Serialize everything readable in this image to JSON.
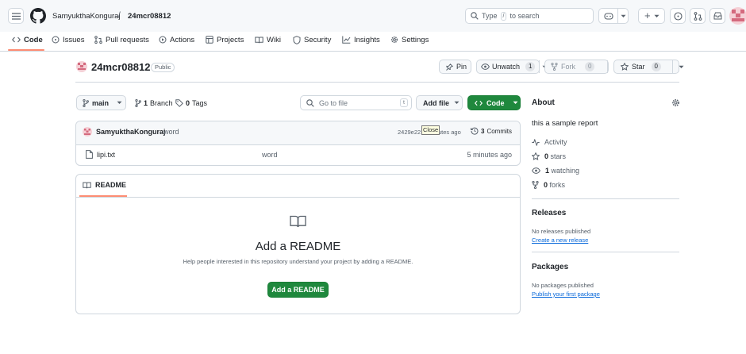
{
  "header": {
    "owner": "SamyukthaKonguraj",
    "separator": "/",
    "repo": "24mcr08812",
    "search_prefix": "Type",
    "search_key": "/",
    "search_suffix": "to search",
    "plus_label": "+"
  },
  "tabs": [
    {
      "label": "Code"
    },
    {
      "label": "Issues"
    },
    {
      "label": "Pull requests"
    },
    {
      "label": "Actions"
    },
    {
      "label": "Projects"
    },
    {
      "label": "Wiki"
    },
    {
      "label": "Security"
    },
    {
      "label": "Insights"
    },
    {
      "label": "Settings"
    }
  ],
  "repo_header": {
    "name": "24mcr08812",
    "visibility": "Public",
    "pin": "Pin",
    "unwatch": "Unwatch",
    "unwatch_count": "1",
    "fork": "Fork",
    "fork_count": "0",
    "star": "Star",
    "star_count": "0"
  },
  "toolbar": {
    "branch": "main",
    "branch_count": "1",
    "branch_word": "Branch",
    "tag_count": "0",
    "tag_word": "Tags",
    "goto_placeholder": "Go to file",
    "goto_key": "t",
    "add_file": "Add file",
    "code": "Code"
  },
  "commit": {
    "author": "SamyukthaKonguraj",
    "message": "word",
    "hash": "2429e22",
    "tooltip": "Close",
    "time_partial": "utes ago",
    "commits_count": "3",
    "commits_word": "Commits"
  },
  "files": [
    {
      "name": "lipi.txt",
      "message": "word",
      "time": "5 minutes ago"
    }
  ],
  "readme": {
    "tab": "README",
    "title": "Add a README",
    "description": "Help people interested in this repository understand your project by adding a README.",
    "button": "Add a README"
  },
  "about": {
    "heading": "About",
    "description": "this a sample report",
    "activity": "Activity",
    "stars_count": "0",
    "stars_word": "stars",
    "watching_count": "1",
    "watching_word": "watching",
    "forks_count": "0",
    "forks_word": "forks"
  },
  "releases": {
    "heading": "Releases",
    "empty": "No releases published",
    "link": "Create a new release"
  },
  "packages": {
    "heading": "Packages",
    "empty": "No packages published",
    "link": "Publish your first package"
  },
  "colors": {
    "accent_green": "#1f883d",
    "link_blue": "#0969da",
    "tab_underline": "#fd8c73"
  }
}
